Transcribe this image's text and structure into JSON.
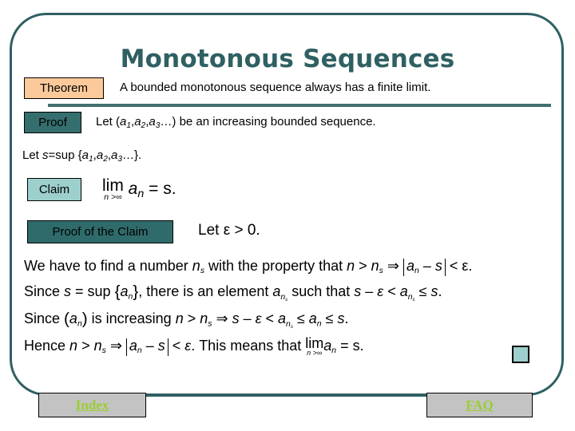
{
  "slide": {
    "title": "Monotonous Sequences",
    "title_color": "#2f6062",
    "frame_color": "#2f6062",
    "background": "#ffffff"
  },
  "labels": {
    "theorem": "Theorem",
    "proof": "Proof",
    "claim": "Claim",
    "proof_of_the_claim": "Proof of the Claim"
  },
  "colors": {
    "theorem_box": "#fbc99a",
    "proof_box": "#356e6e",
    "claim_box": "#9dcfcc",
    "proof_claim_box": "#2f6b6b",
    "qed_box": "#9dcfcc",
    "nav_button": "#c3c3c3",
    "nav_link_text": "#9acd32",
    "divider": "#41706f"
  },
  "statements": {
    "theorem_text": "A bounded monotonous sequence always has a finite limit.",
    "proof_text_prefix": "Let  (",
    "proof_text_seq_a": "a",
    "proof_text_sub1": "1",
    "proof_text_sub2": "2",
    "proof_text_sub3": "3",
    "proof_text_suffix": ")  be an increasing bounded sequence.",
    "sup_line_prefix": "Let  ",
    "sup_line_s": "s",
    "sup_line_eqsup": "=sup  {",
    "sup_line_suffix": "}.",
    "claim_equation_text": "lim aₙ = s.",
    "claim_lim_op": "lim",
    "claim_lim_under": "n >∞",
    "claim_lim_body_a": "a",
    "claim_lim_body_sub": "n",
    "claim_lim_body_tail": "= s.",
    "epsilon_line": "Let ε > 0."
  },
  "proof_lines": {
    "line1": {
      "t1": "We have to find a number  ",
      "m1": "n",
      "s1": "s",
      "t2": " with the property that ",
      "m2": "n",
      "t3": " > ",
      "m3": "n",
      "s3": "s",
      "t4": " ⇒ ",
      "abs_a": "a",
      "abs_sub": "n",
      "abs_tail": " – s",
      "t5": " < ε."
    },
    "line2": {
      "t1": "Since ",
      "m1": "s",
      "t2": " = sup ",
      "set_open": "{",
      "set_a": "a",
      "set_sub": "n",
      "set_close": "}",
      "t3": ",  there is an element  ",
      "m2": "a",
      "s2": "n",
      "s2b": "s",
      "t4": "  such that ",
      "m3": "s",
      "t5": " – ",
      "eps": "ε",
      "t6": " < ",
      "m4": "a",
      "s4": "n",
      "s4b": "s",
      "t7": " ≤ ",
      "m5": "s",
      "t8": "."
    },
    "line3": {
      "t1": "Since ",
      "p_open": "(",
      "m1": "a",
      "s1": "n",
      "p_close": ")",
      "t2": " is increasing  ",
      "m2": "n",
      "t3": " > ",
      "m3": "n",
      "s3": "s",
      "t4": " ⇒ ",
      "m4": "s",
      "t5": " – ",
      "eps": "ε",
      "t6": " < ",
      "m5": "a",
      "s5": "n",
      "s5b": "s",
      "t7": " ≤ ",
      "m6": "a",
      "s6": "n",
      "t8": " ≤ ",
      "m7": "s",
      "t9": "."
    },
    "line4": {
      "t1": "Hence  ",
      "m1": "n",
      "t2": " > ",
      "m2": "n",
      "s2": "s",
      "t3": " ⇒ ",
      "abs_a": "a",
      "abs_sub": "n",
      "abs_tail": " – s",
      "t4": " < ",
      "eps": "ε",
      "t5": ".  This means that  ",
      "lim_op": "lim",
      "lim_under": "n >∞",
      "lim_a": "a",
      "lim_sub": "n",
      "lim_tail": "= s."
    }
  },
  "footer": {
    "index_label": "Index",
    "faq_label": "FAQ"
  }
}
